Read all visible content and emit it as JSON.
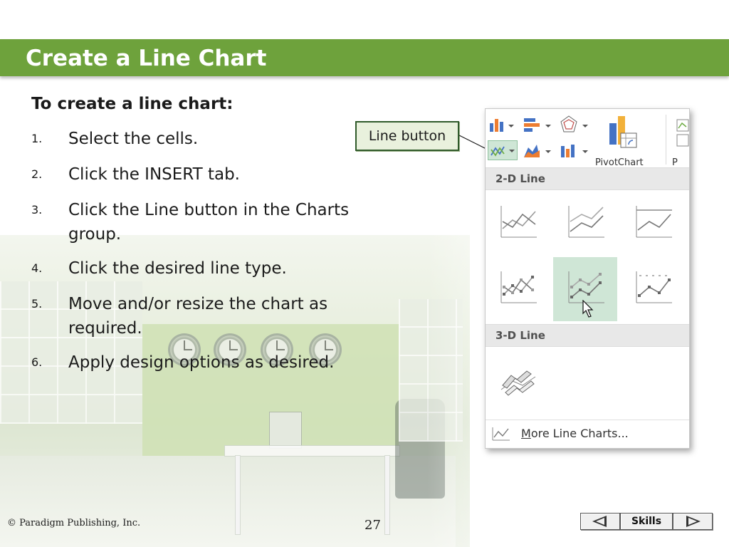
{
  "slide": {
    "title": "Create a Line Chart",
    "intro": "To create a line chart:",
    "steps": [
      {
        "num": "1.",
        "text": "Select the cells."
      },
      {
        "num": "2.",
        "text": "Click the INSERT tab."
      },
      {
        "num": "3.",
        "text": "Click the Line button in the Charts group."
      },
      {
        "num": "4.",
        "text": "Click the desired line type."
      },
      {
        "num": "5.",
        "text": "Move and/or resize the chart as required."
      },
      {
        "num": "6.",
        "text": "Apply design options as desired."
      }
    ],
    "callout": "Line button"
  },
  "gallery": {
    "ribbon_pivot_label": "PivotChart",
    "ribbon_edge_label": "P",
    "section_2d": "2-D Line",
    "section_3d": "3-D Line",
    "more_prefix": "M",
    "more_rest": "ore Line Charts...",
    "options_2d": [
      "line-icon",
      "stacked-line-icon",
      "100-stacked-line-icon",
      "line-with-markers-icon",
      "stacked-line-with-markers-icon",
      "100-stacked-line-with-markers-icon"
    ],
    "options_3d": [
      "3d-line-icon"
    ],
    "highlight_color": "#cfe6d6"
  },
  "footer": {
    "copyright": "© Paradigm Publishing, Inc.",
    "page": "27",
    "skills": "Skills"
  },
  "colors": {
    "header_green": "#6ea23c",
    "callout_border": "#2f5a2a",
    "callout_fill": "#e9f1dd"
  }
}
